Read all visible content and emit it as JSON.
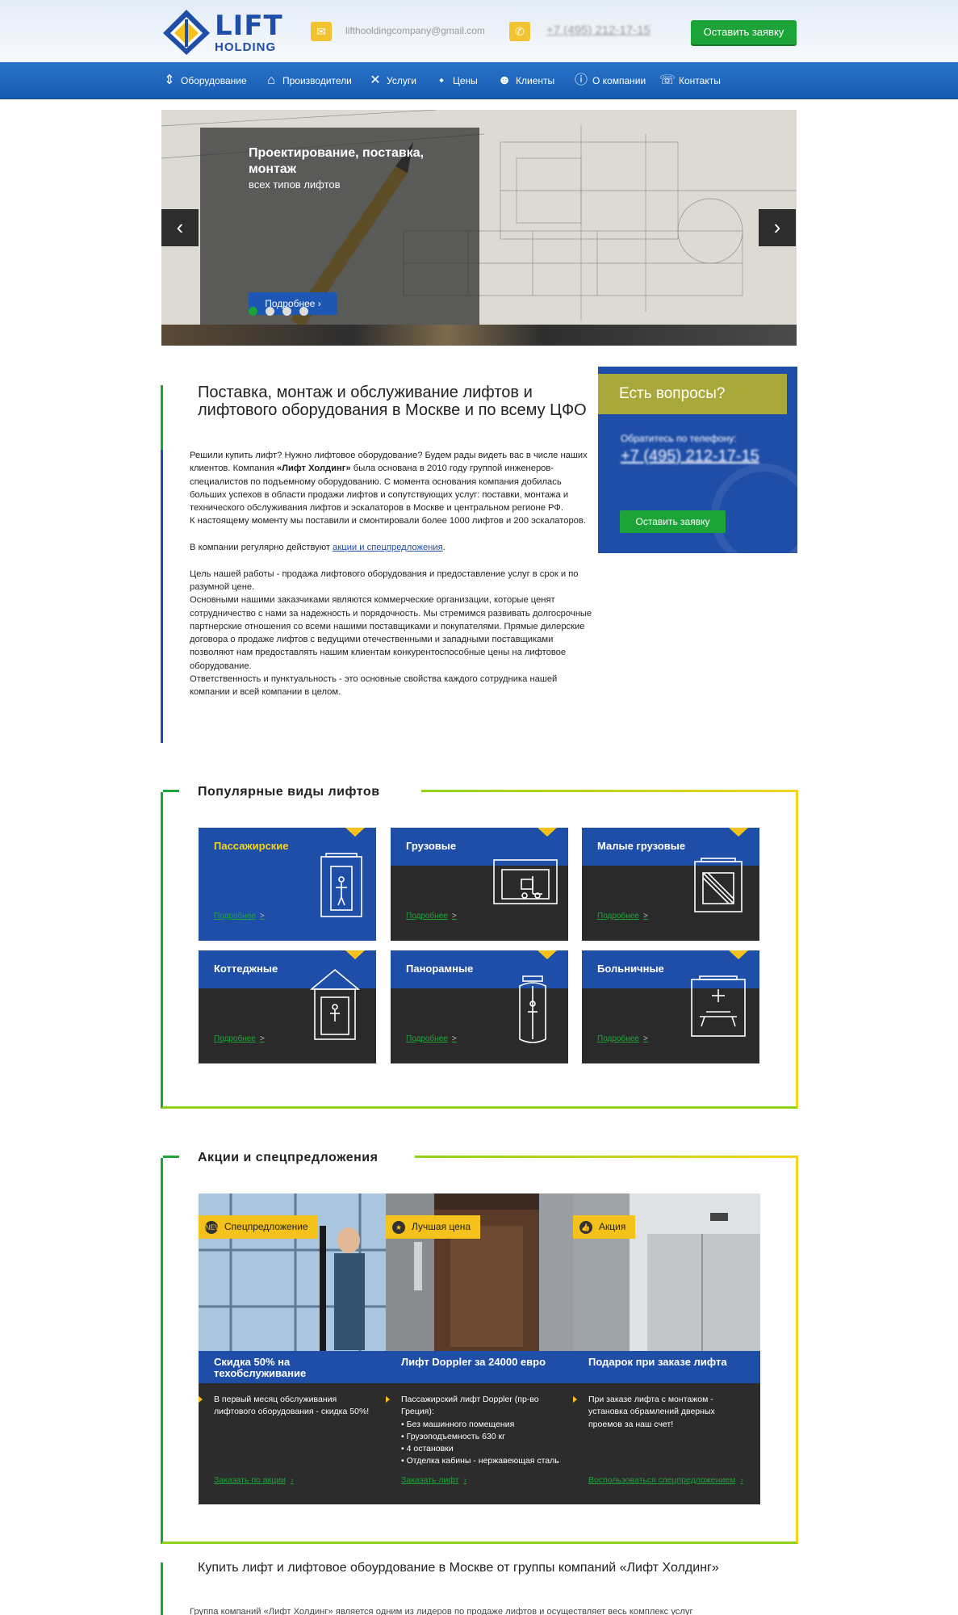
{
  "header": {
    "logo_top": "LIFT",
    "logo_bottom": "HOLDING",
    "email": "lifthooldingcompany@gmail.com",
    "phone": "+7 (495) 212-17-15",
    "request_button": "Оставить заявку"
  },
  "nav": {
    "items": [
      {
        "label": "Оборудование",
        "icon": "elevator-icon"
      },
      {
        "label": "Производители",
        "icon": "factory-icon"
      },
      {
        "label": "Услуги",
        "icon": "tools-icon"
      },
      {
        "label": "Цены",
        "icon": "price-tag-icon"
      },
      {
        "label": "Клиенты",
        "icon": "user-icon"
      },
      {
        "label": "О компании",
        "icon": "info-icon"
      },
      {
        "label": "Контакты",
        "icon": "contacts-icon"
      }
    ]
  },
  "slider": {
    "title": "Проектирование, поставка, монтаж",
    "subtitle": "всех типов лифтов",
    "button": "Подробнее",
    "prev": "‹",
    "next": "›"
  },
  "intro": {
    "title": "Поставка, монтаж и обслуживание лифтов и лифтового оборудования в Москве и по всему ЦФО",
    "p1a": "Решили купить лифт? Нужно лифтовое оборудование? Будем рады видеть вас в числе наших клиентов. Компания ",
    "p1b": "«Лифт Холдинг»",
    "p1c": " была основана в 2010 году группой инженеров-специалистов по подъемному оборудованию. С момента основания компания добилась больших успехов в области продажи лифтов и сопутствующих услуг: поставки, монтажа и технического обслуживания лифтов и эскалаторов в Москве и центральном регионе РФ.",
    "p2": "К настоящему моменту мы поставили и смонтировали более 1000 лифтов и 200 эскалаторов.",
    "p3a": "В компании регулярно действуют ",
    "p3link": "акции и спецпредложения",
    "p3b": ".",
    "p4": "Цель нашей работы - продажа лифтового оборудования и предоставление услуг в срок и по разумной цене.",
    "p5": "Основными нашими заказчиками являются коммерческие организации, которые ценят сотрудничество с нами за надежность и порядочность. Мы стремимся развивать долгосрочные партнерские отношения со всеми нашими поставщиками и покупателями. Прямые дилерские договора о продаже лифтов с ведущими отечественными и западными поставщиками позволяют нам предоставлять нашим клиентам конкурентоспособные цены на лифтовое оборудование.",
    "p6": "Ответственность и пунктуальность - это основные свойства каждого сотрудника нашей компании и всей компании в целом."
  },
  "questions": {
    "title": "Есть вопросы?",
    "subtitle": "Обратитесь по телефону:",
    "phone": "+7 (495) 212-17-15",
    "button": "Оставить заявку"
  },
  "popular": {
    "title": "Популярные виды лифтов",
    "more": "Подробнее",
    "arrow": ">",
    "tiles": [
      {
        "name": "Пассажирские",
        "icon": "passenger-lift-icon"
      },
      {
        "name": "Грузовые",
        "icon": "freight-lift-icon"
      },
      {
        "name": "Малые грузовые",
        "icon": "small-freight-lift-icon"
      },
      {
        "name": "Коттеджные",
        "icon": "cottage-lift-icon"
      },
      {
        "name": "Панорамные",
        "icon": "panoramic-lift-icon"
      },
      {
        "name": "Больничные",
        "icon": "hospital-lift-icon"
      }
    ]
  },
  "promos": {
    "title": "Акции и спецпредложения",
    "items": [
      {
        "badge": "Спецпредложение",
        "badge_icon": "new-icon",
        "title": "Скидка 50% на техобслуживание",
        "lines": [
          "В первый месяц обслуживания лифтового оборудования - скидка 50%!"
        ],
        "link": "Заказать по акции"
      },
      {
        "badge": "Лучшая цена",
        "badge_icon": "star-icon",
        "title": "Лифт Doppler за 24000 евро",
        "lines": [
          "Пассажирский лифт Doppler (пр-во Греция):",
          "• Без машинного помещения",
          "• Грузоподъемность 630 кг",
          "• 4 остановки",
          "• Отделка кабины - нержавеющая сталь"
        ],
        "link": "Заказать лифт"
      },
      {
        "badge": "Акция",
        "badge_icon": "thumbs-up-icon",
        "title": "Подарок при заказе лифта",
        "lines": [
          "При заказе лифта с монтажом - установка обрамлений дверных проемов за наш счет!"
        ],
        "link": "Воспользоваться спецпредложением"
      }
    ]
  },
  "bottom": {
    "title": "Купить лифт и лифтовое обоурдование в Москве от группы компаний «Лифт Холдинг»",
    "text": "Группа компаний «Лифт Холдинг» является одним из лидеров по продаже лифтов и осуществляет весь комплекс услуг"
  },
  "colors": {
    "brand_blue": "#1f4ea8",
    "green": "#1da438",
    "yellow": "#f4c21b",
    "olive": "#a9a83a",
    "dark": "#2a2a2a"
  }
}
